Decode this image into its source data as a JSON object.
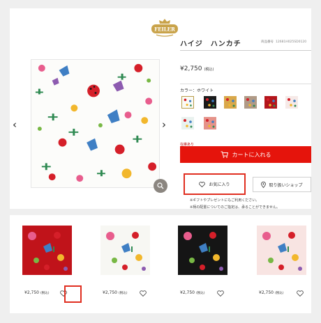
{
  "brand": {
    "logo_text": "FEILER"
  },
  "product": {
    "title": "ハイジ　ハンカチ",
    "code_label": "商品番号",
    "code": "12681H025SD0120",
    "price": "¥2,750",
    "tax": "(税込)",
    "color_label": "カラー：ホワイト",
    "stock_note": "在庫あり",
    "cart_label": "カートに入れる",
    "favorite_label": "お気に入り",
    "shop_label": "取り扱いショップ",
    "note1": "※ギフトやプレゼントにもご利用ください。",
    "note2": "※柄の配置についてのご指定は、承ることができません。"
  },
  "swatches": [
    {
      "bg": "#fafaf5",
      "selected": true
    },
    {
      "bg": "#1a1a1a",
      "selected": false
    },
    {
      "bg": "#d9a84a",
      "selected": false
    },
    {
      "bg": "#b09a86",
      "selected": false
    },
    {
      "bg": "#b3151b",
      "selected": false
    },
    {
      "bg": "#f6e9e7",
      "selected": false
    },
    {
      "bg": "#e9f2ef",
      "selected": false
    },
    {
      "bg": "#e5938a",
      "selected": false
    }
  ],
  "related": [
    {
      "bg": "#c0131a",
      "price": "¥2,750",
      "tax": "(税込)"
    },
    {
      "bg": "#f7f7f3",
      "price": "¥2,750",
      "tax": "(税込)"
    },
    {
      "bg": "#151515",
      "price": "¥2,750",
      "tax": "(税込)"
    },
    {
      "bg": "#f8e4e2",
      "price": "¥2,750",
      "tax": "(税込)"
    }
  ],
  "icons": {
    "prev": "chevron-left-icon",
    "next": "chevron-right-icon",
    "zoom": "magnifier-icon",
    "cart": "cart-icon",
    "favorite": "heart-icon",
    "shop": "location-pin-icon"
  },
  "colors": {
    "accent": "#e5140c",
    "highlight": "#e02e20",
    "gold": "#b99d4a"
  }
}
